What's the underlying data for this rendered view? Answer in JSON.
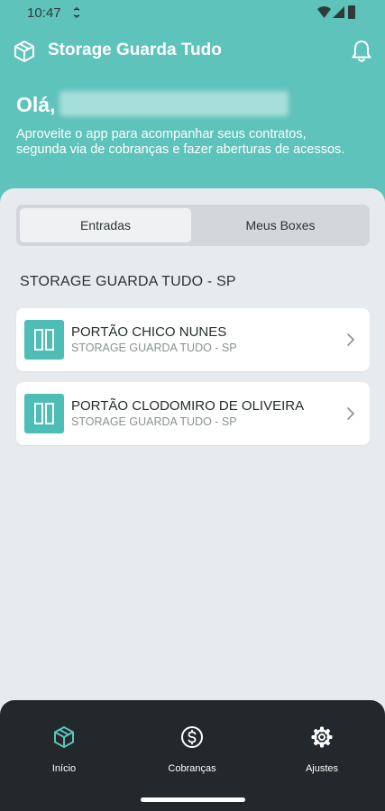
{
  "status_bar": {
    "time": "10:47"
  },
  "header": {
    "title": "Storage Guarda Tudo",
    "logo_icon": "box-icon",
    "bell_icon": "bell-icon"
  },
  "greeting": {
    "hello": "Olá,",
    "intro": "Aproveite o app para acompanhar seus contratos, segunda via de cobranças e fazer aberturas de acessos."
  },
  "tabs": [
    {
      "label": "Entradas",
      "active": true
    },
    {
      "label": "Meus Boxes",
      "active": false
    }
  ],
  "section": {
    "title": "STORAGE GUARDA TUDO - SP"
  },
  "gates": [
    {
      "name": "PORTÃO CHICO NUNES",
      "location": "STORAGE GUARDA TUDO - SP"
    },
    {
      "name": "PORTÃO CLODOMIRO DE OLIVEIRA",
      "location": "STORAGE GUARDA TUDO - SP"
    }
  ],
  "bottom_nav": [
    {
      "label": "Início",
      "icon": "box-icon",
      "active": true
    },
    {
      "label": "Cobranças",
      "icon": "dollar-circle-icon",
      "active": false
    },
    {
      "label": "Ajustes",
      "icon": "gear-icon",
      "active": false
    }
  ],
  "colors": {
    "primary": "#5ec3bb",
    "accent": "#4dbdb5",
    "background": "#e8ebee",
    "nav_background": "#22282b",
    "active_nav_icon": "#5ec3bb"
  }
}
